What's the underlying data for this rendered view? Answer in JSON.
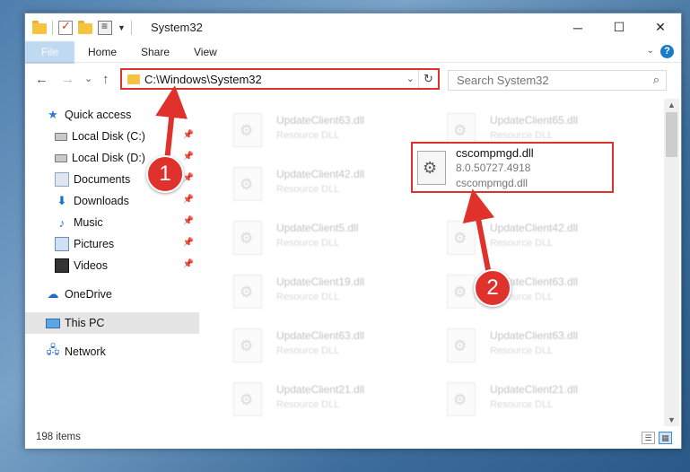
{
  "window": {
    "title": "System32"
  },
  "ribbon": {
    "tabs": [
      "File",
      "Home",
      "Share",
      "View"
    ]
  },
  "nav": {
    "back": "←",
    "forward": "→",
    "recent": "⌄",
    "up": "↑"
  },
  "address": {
    "path": "C:\\Windows\\System32"
  },
  "search": {
    "placeholder": "Search System32"
  },
  "sidebar": {
    "items": [
      {
        "label": "Quick access",
        "icon": "star-icon"
      },
      {
        "label": "Local Disk (C:)",
        "icon": "disk-icon"
      },
      {
        "label": "Local Disk (D:)",
        "icon": "disk-icon"
      },
      {
        "label": "Documents",
        "icon": "documents-icon"
      },
      {
        "label": "Downloads",
        "icon": "downloads-icon"
      },
      {
        "label": "Music",
        "icon": "music-icon"
      },
      {
        "label": "Pictures",
        "icon": "pictures-icon"
      },
      {
        "label": "Videos",
        "icon": "videos-icon"
      },
      {
        "label": "OneDrive",
        "icon": "onedrive-icon"
      },
      {
        "label": "This PC",
        "icon": "this-pc-icon"
      },
      {
        "label": "Network",
        "icon": "network-icon"
      }
    ]
  },
  "files": {
    "left": [
      {
        "name": "UpdateClient63.dll",
        "desc": "Resource DLL"
      },
      {
        "name": "UpdateClient42.dll",
        "desc": "Resource DLL"
      },
      {
        "name": "UpdateClient5.dll",
        "desc": "Resource DLL"
      },
      {
        "name": "UpdateClient19.dll",
        "desc": "Resource DLL"
      },
      {
        "name": "UpdateClient63.dll",
        "desc": "Resource DLL"
      },
      {
        "name": "UpdateClient21.dll",
        "desc": "Resource DLL"
      }
    ],
    "right": [
      {
        "name": "UpdateClient65.dll",
        "desc": "Resource DLL"
      },
      {
        "name": "UpdateClient42.dll",
        "desc": "Resource DLL"
      },
      {
        "name": "UpdateClient63.dll",
        "desc": "Resource DLL"
      },
      {
        "name": "UpdateClient63.dll",
        "desc": "Resource DLL"
      },
      {
        "name": "UpdateClient21.dll",
        "desc": "Resource DLL"
      }
    ]
  },
  "highlighted_file": {
    "name": "cscompmgd.dll",
    "version": "8.0.50727.4918",
    "description": "cscompmgd.dll"
  },
  "status": {
    "item_count": "198 items"
  },
  "annotations": {
    "step1": "1",
    "step2": "2"
  },
  "colors": {
    "accent": "#1979ca",
    "highlight": "#e0322c"
  }
}
